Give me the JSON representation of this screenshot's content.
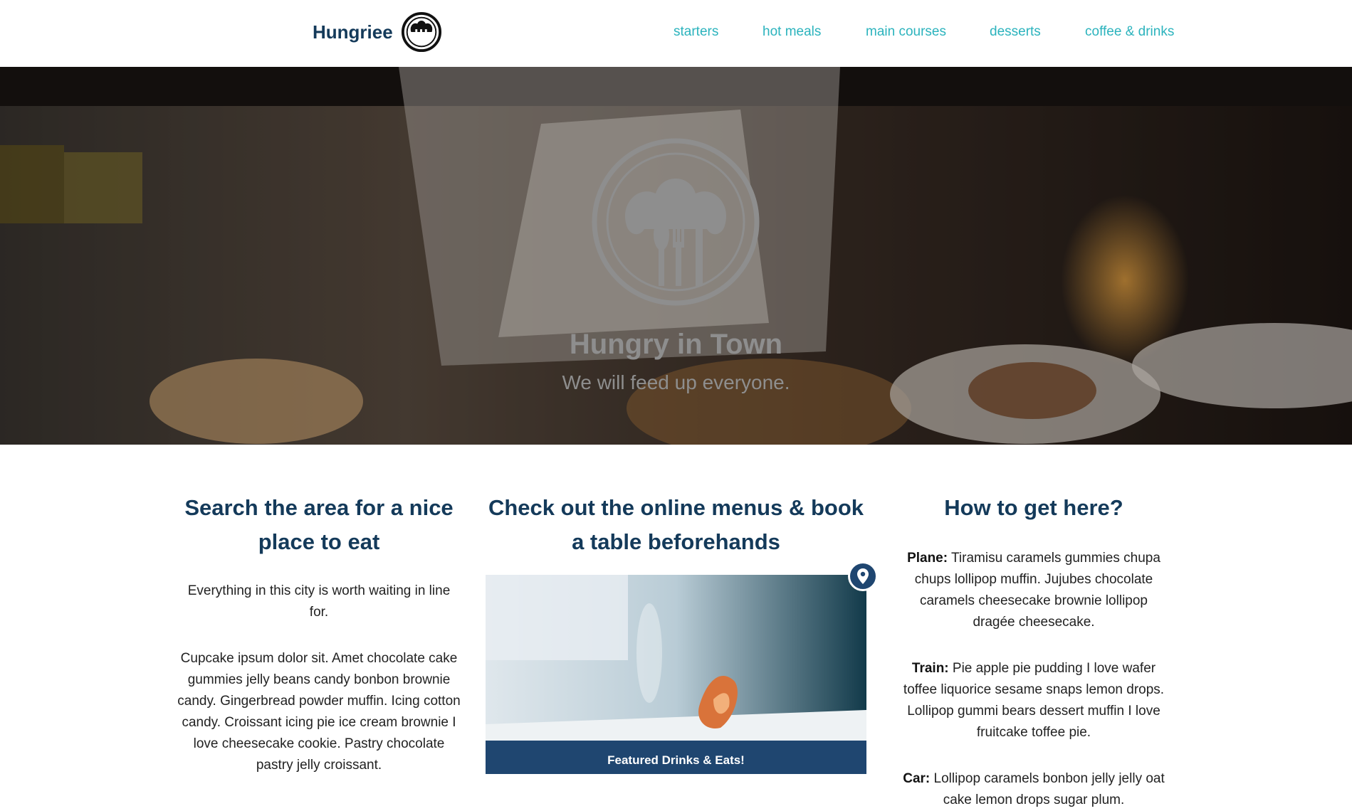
{
  "header": {
    "brand": "Hungriee",
    "logo_icon": "chef-hat-cutlery-icon",
    "nav": [
      {
        "label": "starters"
      },
      {
        "label": "hot meals"
      },
      {
        "label": "main courses"
      },
      {
        "label": "desserts"
      },
      {
        "label": "coffee & drinks"
      }
    ]
  },
  "hero": {
    "title": "Hungry in Town",
    "subtitle": "We will feed up everyone."
  },
  "columns": {
    "search": {
      "title": "Search the area for a nice place to eat",
      "intro": "Everything in this city is worth waiting in line for.",
      "body": "Cupcake ipsum dolor sit. Amet chocolate cake gummies jelly beans candy bonbon brownie candy. Gingerbread powder muffin. Icing cotton candy. Croissant icing pie ice cream brownie I love cheesecake cookie. Pastry chocolate pastry jelly croissant."
    },
    "menus": {
      "title": "Check out the online menus & book a table beforehands",
      "card_banner": "Featured Drinks & Eats!",
      "pin_icon": "location-pin-icon"
    },
    "directions": {
      "title": "How to get here?",
      "items": [
        {
          "label": "Plane:",
          "text": " Tiramisu caramels gummies chupa chups lollipop muffin. Jujubes chocolate caramels cheesecake brownie lollipop dragée cheesecake."
        },
        {
          "label": "Train:",
          "text": " Pie apple pie pudding I love wafer toffee liquorice sesame snaps lemon drops. Lollipop gummi bears dessert muffin I love fruitcake toffee pie."
        },
        {
          "label": "Car:",
          "text": " Lollipop caramels bonbon jelly jelly oat cake lemon drops sugar plum."
        }
      ]
    }
  },
  "colors": {
    "brand_navy": "#143a5a",
    "nav_teal": "#2bb3bd",
    "banner_blue": "#1f4670"
  }
}
